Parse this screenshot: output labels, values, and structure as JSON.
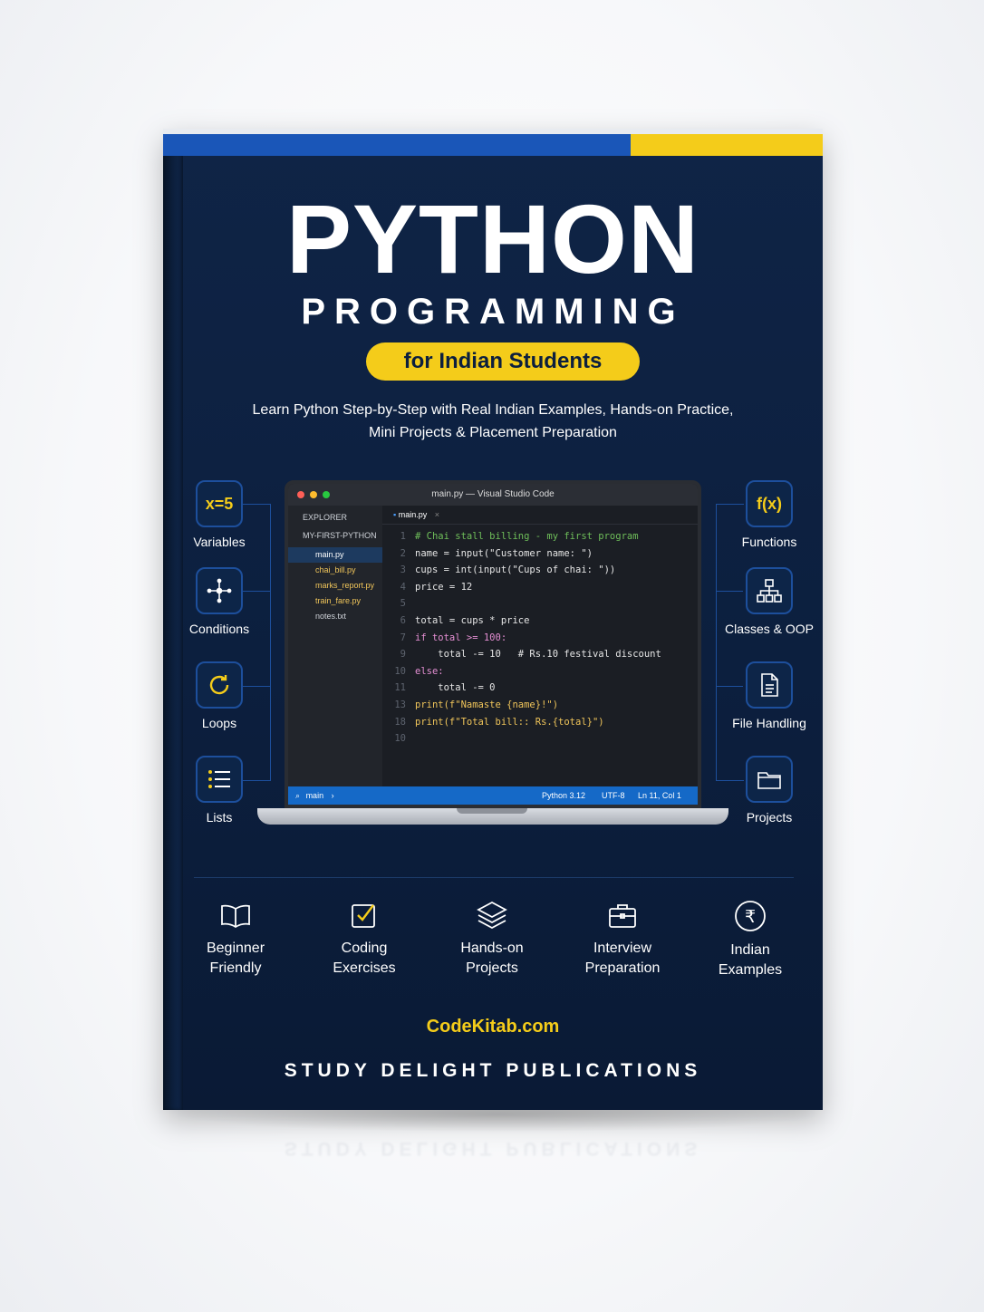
{
  "cover": {
    "title": "PYTHON",
    "subtitle": "PROGRAMMING",
    "audience": "for Indian Students",
    "tagline_line1": "Learn Python Step-by-Step with Real Indian Examples, Hands-on Practice,",
    "tagline_line2": "Mini Projects & Placement Preparation",
    "website": "CodeKitab.com",
    "publisher": "STUDY DELIGHT PUBLICATIONS",
    "colors": {
      "navy": "#0f2446",
      "yellow": "#f4cc1a",
      "blue": "#1a56b8"
    }
  },
  "left_features": [
    {
      "label": "Variables",
      "icon_text": "x=5"
    },
    {
      "label": "Conditions",
      "icon": "branch-icon"
    },
    {
      "label": "Loops",
      "icon": "loop-icon"
    },
    {
      "label": "Lists",
      "icon": "list-icon"
    }
  ],
  "right_features": [
    {
      "label": "Functions",
      "icon_text": "f(x)"
    },
    {
      "label": "Classes & OOP",
      "icon": "hierarchy-icon"
    },
    {
      "label": "File Handling",
      "icon": "document-icon"
    },
    {
      "label": "Projects",
      "icon": "folder-icon"
    }
  ],
  "editor": {
    "window_title": "main.py — Visual Studio Code",
    "explorer_header": "EXPLORER",
    "project": "MY-FIRST-PYTHON",
    "files": [
      "main.py",
      "chai_bill.py",
      "marks_report.py",
      "train_fare.py",
      "notes.txt"
    ],
    "tab": "main.py",
    "lines": [
      {
        "n": "1",
        "code": "# Chai stall billing - my first program"
      },
      {
        "n": "2",
        "code": "name = input(\"Customer name: \")"
      },
      {
        "n": "3",
        "code": "cups = int(input(\"Cups of chai: \"))"
      },
      {
        "n": "4",
        "code": "price = 12"
      },
      {
        "n": "5",
        "code": ""
      },
      {
        "n": "6",
        "code": "total = cups * price"
      },
      {
        "n": "7",
        "code": "if total >= 100:"
      },
      {
        "n": "9",
        "code": "    total -= 10   # Rs.10 festival discount"
      },
      {
        "n": "10",
        "code": "else:"
      },
      {
        "n": "11",
        "code": "    total -= 0"
      },
      {
        "n": "13",
        "code": "print(f\"Namaste {name}!\")"
      },
      {
        "n": "18",
        "code": "print(f\"Total bill:: Rs.{total}\")"
      },
      {
        "n": "10",
        "code": ""
      }
    ],
    "status_branch": "main",
    "status_python": "Python  3.12",
    "status_encoding": "UTF-8",
    "status_position": "Ln 11, Col 1"
  },
  "bottom_features": [
    {
      "line1": "Beginner",
      "line2": "Friendly",
      "icon": "open-book-icon"
    },
    {
      "line1": "Coding",
      "line2": "Exercises",
      "icon": "checkbox-icon"
    },
    {
      "line1": "Hands-on",
      "line2": "Projects",
      "icon": "layers-icon"
    },
    {
      "line1": "Interview",
      "line2": "Preparation",
      "icon": "briefcase-icon"
    },
    {
      "line1": "Indian",
      "line2": "Examples",
      "icon": "rupee-icon"
    }
  ]
}
